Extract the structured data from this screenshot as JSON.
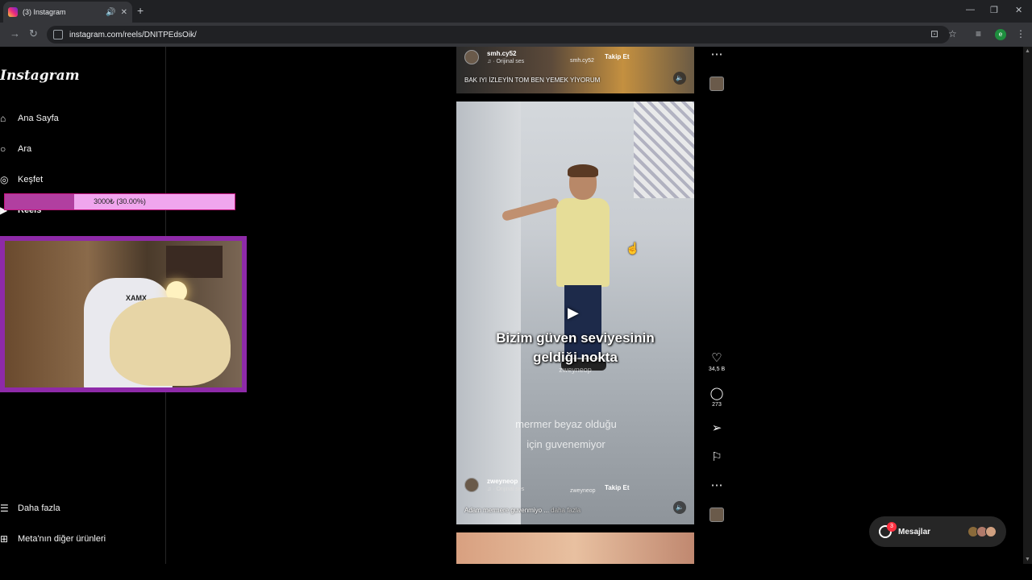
{
  "browser": {
    "tab_title": "(3) Instagram",
    "url": "instagram.com/reels/DNITPEdsOik/",
    "profile_initial": "e"
  },
  "sidebar": {
    "logo": "Instagram",
    "items": [
      {
        "label": "Ana Sayfa",
        "icon": "home-icon"
      },
      {
        "label": "Ara",
        "icon": "search-icon"
      },
      {
        "label": "Keşfet",
        "icon": "compass-icon"
      },
      {
        "label": "Reels",
        "icon": "reels-icon"
      }
    ],
    "bottom_items": [
      {
        "label": "Daha fazla",
        "icon": "menu-icon"
      },
      {
        "label": "Meta'nın diğer ürünleri",
        "icon": "meta-icon"
      }
    ]
  },
  "stream_overlay": {
    "goal_text": "3000₺ (30.00%)",
    "goal_progress": 0.3,
    "cam_text": "XAMX"
  },
  "reels": {
    "previous": {
      "username": "smh.cy52",
      "audio": "· Orijinal ses",
      "audio_user": "smh.cy52",
      "follow": "Takip Et",
      "description": "BAK IYI İZLEYİN TOM BEN YEMEK YİYORUM"
    },
    "current": {
      "username": "zweyneop",
      "audio": "· Orijinal ses",
      "audio_user": "zweyneop",
      "follow": "Takip Et",
      "description": "Adam mermere guvenmiyo ...",
      "more": "daha fazla",
      "caption_big_1": "Bizim güven seviyesinin",
      "caption_big_2": "geldiği nokta",
      "watermark": "zweyneop",
      "caption_small_1": "mermer beyaz olduğu",
      "caption_small_2": "için guvenemiyor",
      "likes": "34,5 B",
      "comments": "273"
    }
  },
  "messages": {
    "label": "Mesajlar",
    "badge": "3"
  },
  "colors": {
    "goal_fill": "#b13fa0",
    "goal_bg": "#f0a6ee",
    "cam_border": "#8e2aa8",
    "badge": "#ff3040"
  }
}
